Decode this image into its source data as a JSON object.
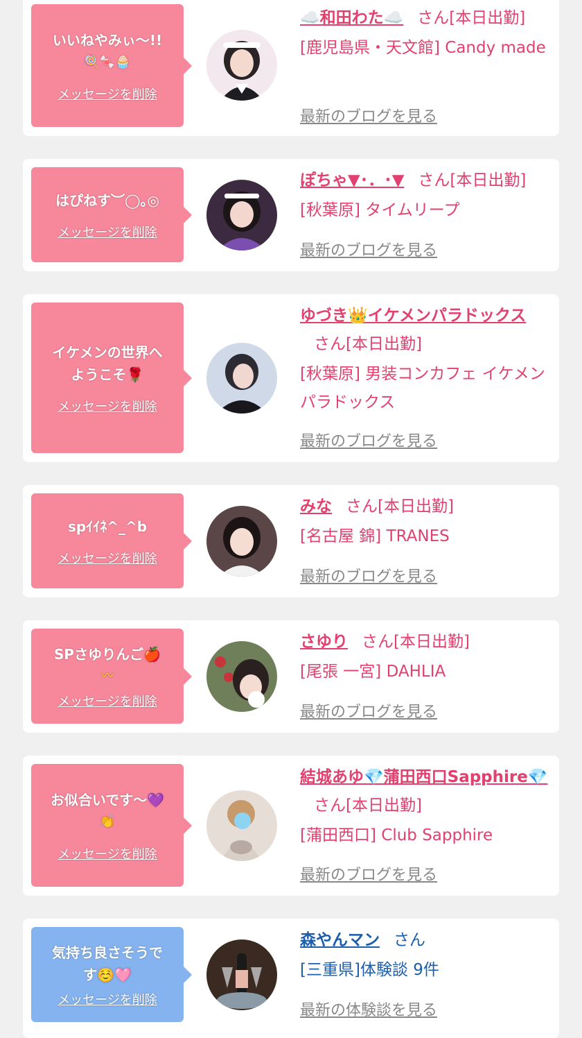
{
  "colors": {
    "accent_pink": "#e2416f",
    "bubble_pink": "#f7889c",
    "bubble_blue": "#85b3ef",
    "accent_blue": "#1c5dad",
    "muted_gray": "#888888"
  },
  "items": [
    {
      "message_line1": "いいねやみぃ〜!!",
      "message_line2": "🍭🍬🧁",
      "delete_label": "メッセージを削除",
      "name": "☁️和田わた☁️",
      "suffix": "さん[本日出勤]",
      "shop": "[鹿児島県・天文館] Candy made",
      "blog_label": "最新のブログを見る",
      "avatar_icon": "girl-maid-avatar"
    },
    {
      "message_line1": "はぴねす︶◯｡◎",
      "message_line2": "",
      "delete_label": "メッセージを削除",
      "name": "ぽちゃ▼･．･▼",
      "suffix": "さん[本日出勤]",
      "shop": "[秋葉原] タイムリープ",
      "blog_label": "最新のブログを見る",
      "avatar_icon": "girl-maid-avatar"
    },
    {
      "message_line1": "イケメンの世界へ",
      "message_line2": "ようこそ🌹",
      "delete_label": "メッセージを削除",
      "name": "ゆづき👑イケメンパラドックス",
      "suffix": "さん[本日出勤]",
      "shop": "[秋葉原] 男装コンカフェ イケメンパラドックス",
      "blog_label": "最新のブログを見る",
      "avatar_icon": "host-avatar"
    },
    {
      "message_line1": "spｲｲﾈ^_^b",
      "message_line2": "",
      "delete_label": "メッセージを削除",
      "name": "みな",
      "suffix": "さん[本日出勤]",
      "shop": "[名古屋 錦] TRANES",
      "blog_label": "最新のブログを見る",
      "avatar_icon": "girl-avatar"
    },
    {
      "message_line1": "SPさゆりんご🍎",
      "message_line2": "〰",
      "delete_label": "メッセージを削除",
      "name": "さゆり",
      "suffix": "さん[本日出勤]",
      "shop": "[尾張 一宮] DAHLIA",
      "blog_label": "最新のブログを見る",
      "avatar_icon": "girl-strawberry-avatar"
    },
    {
      "message_line1": "お似合いです〜💜",
      "message_line2": "👏",
      "delete_label": "メッセージを削除",
      "name": "結城あゆ💎蒲田西口Sapphire💎",
      "suffix": "さん[本日出勤]",
      "shop": "[蒲田西口] Club Sapphire",
      "blog_label": "最新のブログを見る",
      "avatar_icon": "girl-dress-avatar"
    },
    {
      "message_line1": "気持ち良さそうで",
      "message_line2": "す☺️🩷",
      "delete_label": "メッセージを削除",
      "name": "森やんマン",
      "suffix": "さん",
      "shop": "[三重県]体験談 9件",
      "blog_label": "最新の体験談を見る",
      "avatar_icon": "champagne-avatar"
    }
  ]
}
